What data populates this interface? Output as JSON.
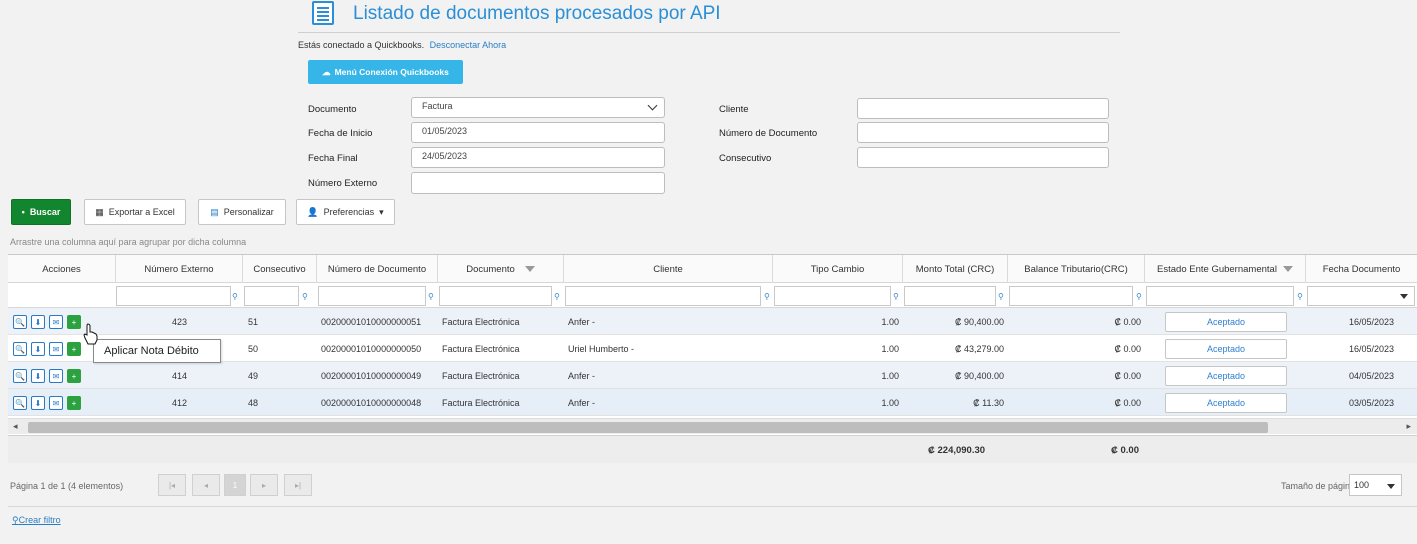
{
  "header": {
    "title": "Listado de documentos procesados por API",
    "connected_text": "Estás conectado a Quickbooks.",
    "disconnect_link": "Desconectar Ahora",
    "qb_menu_button": "Menú Conexión Quickbooks"
  },
  "filters": {
    "documento_label": "Documento",
    "documento_value": "Factura",
    "fecha_inicio_label": "Fecha de Inicio",
    "fecha_inicio_value": "01/05/2023",
    "fecha_final_label": "Fecha Final",
    "fecha_final_value": "24/05/2023",
    "numero_externo_label": "Número Externo",
    "numero_externo_value": "",
    "cliente_label": "Cliente",
    "cliente_value": "",
    "numero_documento_label": "Número de Documento",
    "numero_documento_value": "",
    "consecutivo_label": "Consecutivo",
    "consecutivo_value": ""
  },
  "toolbar": {
    "buscar": "Buscar",
    "exportar": "Exportar a Excel",
    "personalizar": "Personalizar",
    "preferencias": "Preferencias"
  },
  "group_hint": "Arrastre una columna aquí para agrupar por dicha columna",
  "grid": {
    "columns": {
      "acciones": "Acciones",
      "numero_externo": "Número Externo",
      "consecutivo": "Consecutivo",
      "numero_documento": "Número de Documento",
      "documento": "Documento",
      "cliente": "Cliente",
      "tipo_cambio": "Tipo Cambio",
      "monto_total": "Monto Total (CRC)",
      "balance_tributario": "Balance Tributario(CRC)",
      "estado": "Estado Ente Gubernamental",
      "fecha_documento": "Fecha Documento"
    },
    "rows": [
      {
        "numero_externo": "423",
        "consecutivo": "51",
        "numero_documento": "00200001010000000051",
        "documento": "Factura Electrónica",
        "cliente": "Anfer -",
        "tipo_cambio": "1.00",
        "monto_total": "₡ 90,400.00",
        "balance": "₡ 0.00",
        "estado": "Aceptado",
        "fecha": "16/05/2023"
      },
      {
        "numero_externo": "",
        "consecutivo": "50",
        "numero_documento": "00200001010000000050",
        "documento": "Factura Electrónica",
        "cliente": "Uriel Humberto -",
        "tipo_cambio": "1.00",
        "monto_total": "₡ 43,279.00",
        "balance": "₡ 0.00",
        "estado": "Aceptado",
        "fecha": "16/05/2023"
      },
      {
        "numero_externo": "414",
        "consecutivo": "49",
        "numero_documento": "00200001010000000049",
        "documento": "Factura Electrónica",
        "cliente": "Anfer -",
        "tipo_cambio": "1.00",
        "monto_total": "₡ 90,400.00",
        "balance": "₡ 0.00",
        "estado": "Aceptado",
        "fecha": "04/05/2023"
      },
      {
        "numero_externo": "412",
        "consecutivo": "48",
        "numero_documento": "00200001010000000048",
        "documento": "Factura Electrónica",
        "cliente": "Anfer -",
        "tipo_cambio": "1.00",
        "monto_total": "₡ 11.30",
        "balance": "₡ 0.00",
        "estado": "Aceptado",
        "fecha": "03/05/2023"
      }
    ],
    "totals": {
      "monto_total": "₡ 224,090.30",
      "balance": "₡ 0.00"
    }
  },
  "tooltip": "Aplicar Nota Débito",
  "pager": {
    "info": "Página 1 de 1 (4 elementos)",
    "current_page": "1",
    "page_size_label": "Tamaño de página:",
    "page_size": "100"
  },
  "crear_filtro": "Crear filtro",
  "colors": {
    "accent": "#2a8fd6",
    "buscar_green": "#12862f",
    "qb_blue": "#36b6e8",
    "action_green": "#2ba13f"
  }
}
